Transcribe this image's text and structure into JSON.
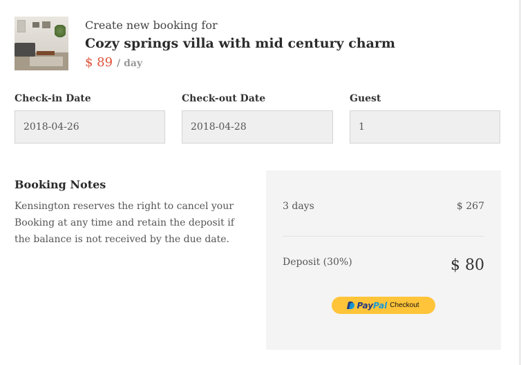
{
  "header": {
    "lead": "Create new booking for",
    "title": "Cozy springs villa with mid century charm",
    "price": "$ 89",
    "per": "/ day",
    "price_color": "#e0523a"
  },
  "fields": [
    {
      "label": "Check-in Date",
      "value": "2018-04-26"
    },
    {
      "label": "Check-out Date",
      "value": "2018-04-28"
    },
    {
      "label": "Guest",
      "value": "1"
    }
  ],
  "notes": {
    "title": "Booking Notes",
    "text": "Kensington reserves the right to cancel your Booking at any time and retain the deposit if the balance is not received by the due date."
  },
  "summary": {
    "duration_label": "3 days",
    "duration_amount": "$ 267",
    "deposit_label": "Deposit (30%)",
    "deposit_amount": "$ 80"
  },
  "paypal": {
    "brand_pay": "Pay",
    "brand_pal": "Pal",
    "label": "Checkout",
    "bg_color": "#ffc439",
    "icon": "paypal-logo-icon"
  }
}
